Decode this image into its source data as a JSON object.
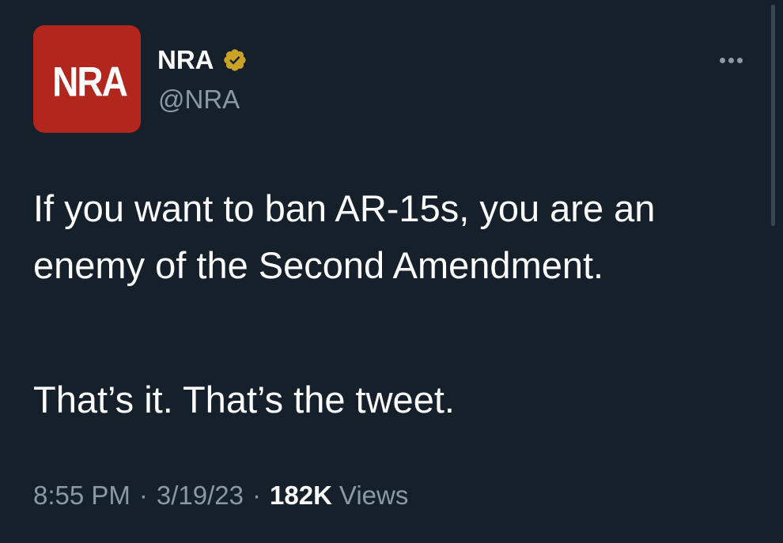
{
  "author": {
    "avatar_text": "NRA",
    "display_name": "NRA",
    "handle": "@NRA",
    "verified_badge_icon": "verified-badge-icon",
    "avatar_color": "#b3261e",
    "verified_color": "#c9a227"
  },
  "tweet": {
    "text_line_1": "If you want to ban AR-15s, you are an enemy of the Second Amendment.",
    "text_line_2": "That’s it. That’s the tweet.",
    "time": "8:55 PM",
    "date": "3/19/23",
    "views_count": "182K",
    "views_label": "Views",
    "separator": "·"
  },
  "more_options_icon": "more-options-icon",
  "theme": {
    "background": "#15202b",
    "primary_text": "#ffffff",
    "secondary_text": "#8b98a5"
  }
}
